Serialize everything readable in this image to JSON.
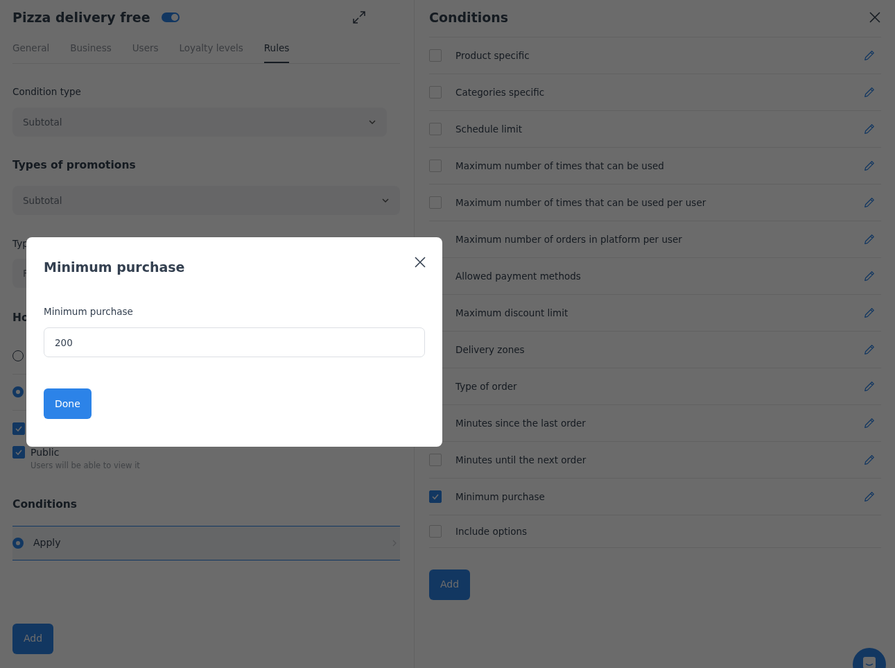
{
  "editor": {
    "title": "Pizza delivery free",
    "enabled": true,
    "tabs": [
      {
        "label": "General",
        "selected": false
      },
      {
        "label": "Business",
        "selected": false
      },
      {
        "label": "Users",
        "selected": false
      },
      {
        "label": "Loyalty levels",
        "selected": false
      },
      {
        "label": "Rules",
        "selected": true
      }
    ],
    "condition_type": {
      "label": "Condition type",
      "value": "Subtotal"
    },
    "types_of_promotions": {
      "heading": "Types of promotions",
      "value": "Subtotal"
    },
    "partial_field": {
      "label": "Typ",
      "value": "F"
    },
    "partial_heading": "Ho",
    "radio_options": [
      {
        "selected": false
      },
      {
        "selected": true
      }
    ],
    "checkboxes": [
      {
        "checked": true
      },
      {
        "checked": true,
        "label": "Public",
        "description": "Users will be able to view it"
      }
    ],
    "conditions": {
      "heading": "Conditions",
      "items": [
        {
          "label": "Apply",
          "selected": true
        }
      ]
    },
    "add_button": "Add"
  },
  "conditions_panel": {
    "title": "Conditions",
    "items": [
      {
        "label": "Product specific",
        "checked": false,
        "editable": true
      },
      {
        "label": "Categories specific",
        "checked": false,
        "editable": true
      },
      {
        "label": "Schedule limit",
        "checked": false,
        "editable": true
      },
      {
        "label": "Maximum number of times that can be used",
        "checked": false,
        "editable": true
      },
      {
        "label": "Maximum number of times that can be used per user",
        "checked": false,
        "editable": true
      },
      {
        "label": "Maximum number of orders in platform per user",
        "editable": true
      },
      {
        "label": "Allowed payment methods",
        "editable": true
      },
      {
        "label": "Maximum discount limit",
        "editable": true
      },
      {
        "label": "Delivery zones",
        "editable": true
      },
      {
        "label": "Type of order",
        "editable": true
      },
      {
        "label": "Minutes since the last order",
        "editable": true
      },
      {
        "label": "Minutes until the next order",
        "checked": false,
        "editable": true
      },
      {
        "label": "Minimum purchase",
        "checked": true,
        "editable": true
      },
      {
        "label": "Include options",
        "checked": false,
        "editable": false
      }
    ],
    "add_button": "Add"
  },
  "modal": {
    "title": "Minimum purchase",
    "field_label": "Minimum purchase",
    "value": "200",
    "done_button": "Done"
  }
}
